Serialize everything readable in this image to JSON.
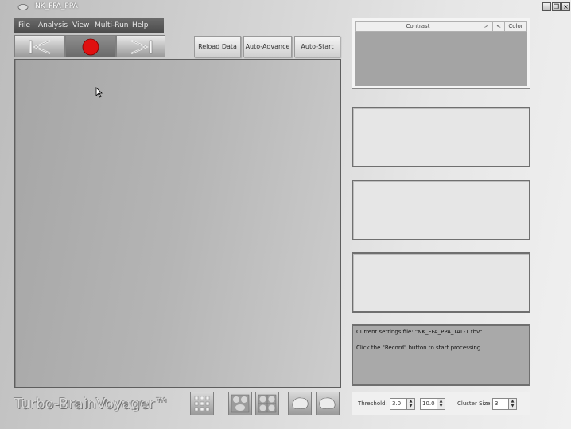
{
  "window": {
    "title": "NK_FFA_PPA",
    "minimize_glyph": "_",
    "restore_glyph": "❐",
    "close_glyph": "×"
  },
  "menu": {
    "items": [
      {
        "label": "File"
      },
      {
        "label": "Analysis"
      },
      {
        "label": "View"
      },
      {
        "label": "Multi-Run"
      },
      {
        "label": "Help"
      }
    ]
  },
  "toolbar": {
    "reload_label": "Reload Data",
    "auto_advance_label": "Auto-Advance",
    "auto_start_label": "Auto-Start"
  },
  "contrast_table": {
    "headers": [
      "Contrast",
      ">",
      "<",
      "Color"
    ]
  },
  "info": {
    "line1": "Current settings file: \"NK_FFA_PPA_TAL-1.tbv\".",
    "line2": "Click the \"Record\" button to start processing."
  },
  "logo": {
    "text": "Turbo-BrainVoyager™"
  },
  "controls": {
    "threshold_label": "Threshold:",
    "threshold_min": "3.0",
    "threshold_max": "10.0",
    "cluster_label": "Cluster Size:",
    "cluster_value": "3"
  },
  "colors": {
    "record": "#e01010",
    "main_view": "#b5b5b5"
  }
}
